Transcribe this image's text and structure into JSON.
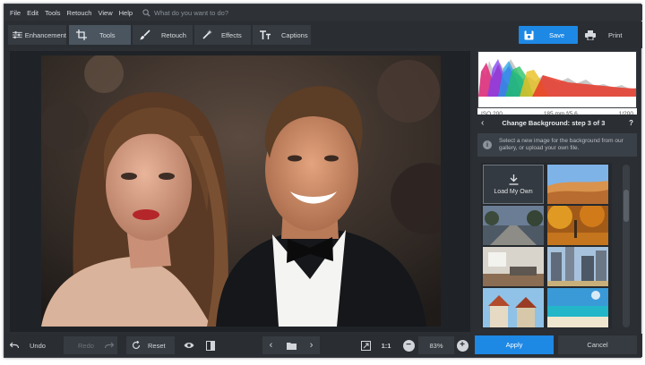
{
  "menu": {
    "items": [
      "File",
      "Edit",
      "Tools",
      "Retouch",
      "View",
      "Help"
    ],
    "search_placeholder": "What do you want to do?"
  },
  "toolbar": {
    "tabs": [
      {
        "label": "Enhancement",
        "icon": "sliders-icon"
      },
      {
        "label": "Tools",
        "icon": "crop-icon",
        "active": true
      },
      {
        "label": "Retouch",
        "icon": "brush-icon"
      },
      {
        "label": "Effects",
        "icon": "magic-wand-icon"
      },
      {
        "label": "Captions",
        "icon": "text-icon"
      }
    ],
    "save_label": "Save",
    "print_label": "Print"
  },
  "histogram": {
    "iso": "ISO 200",
    "lens": "185 mm f/5.6",
    "shutter": "1/200"
  },
  "panel": {
    "step_title": "Change Background: step 3 of 3",
    "help": "?",
    "hint": "Select a new image for the background from our gallery, or upload your own file.",
    "load_label": "Load My Own"
  },
  "bottom": {
    "undo": "Undo",
    "redo": "Redo",
    "reset": "Reset",
    "zoom_ratio": "1:1",
    "zoom_level": "83%",
    "apply": "Apply",
    "cancel": "Cancel"
  },
  "colors": {
    "accent": "#1e88e5",
    "background": "#2b2f34"
  }
}
